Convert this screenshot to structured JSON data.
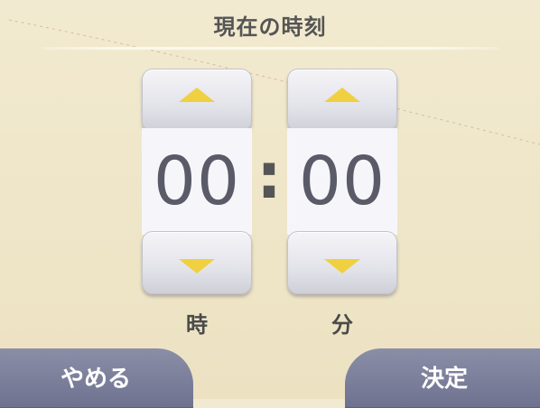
{
  "screen": {
    "title": "現在の時刻"
  },
  "time": {
    "hours": "00",
    "separator": ":",
    "minutes": "00"
  },
  "labels": {
    "hours_unit": "時",
    "minutes_unit": "分"
  },
  "buttons": {
    "cancel": "やめる",
    "confirm": "決定"
  },
  "colors": {
    "background": "#efe6c6",
    "arrow_accent": "#f0d040",
    "bottom_button": "#7a7e9a",
    "digit_text": "#5a5a68"
  },
  "icons": {
    "increment": "triangle-up-icon",
    "decrement": "triangle-down-icon"
  }
}
